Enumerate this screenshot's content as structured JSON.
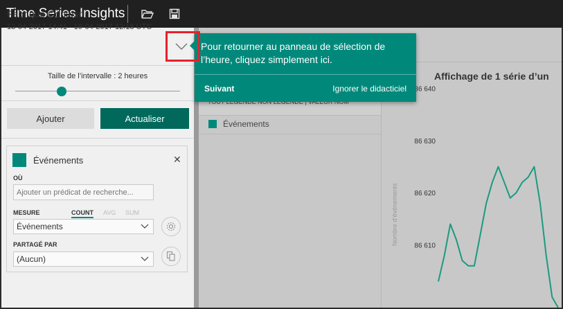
{
  "app": {
    "title": "Time Series Insights"
  },
  "environment": {
    "name": "Fabrique Contoso",
    "range": "13-04-2017 14:41  -  19-04-2017 12:18 UTC"
  },
  "interval": {
    "label": "Taille de l’intervalle : 2 heures",
    "position": 0.28
  },
  "buttons": {
    "add": "Ajouter",
    "refresh": "Actualiser"
  },
  "card": {
    "title": "Événements",
    "where_label": "OÙ",
    "predicate_placeholder": "Ajouter un prédicat de recherche...",
    "measure_label": "MESURE",
    "measure_tabs": [
      "COUNT",
      "AVG",
      "SUM"
    ],
    "measure_value": "Événements",
    "split_label": "PARTAGÉ PAR",
    "split_value": "(Aucun)",
    "accent": "#00897b"
  },
  "middle": {
    "tabs_text": "TOUT   LÉGENDE  NON LÉGENDE    |  VALEUR   NOM",
    "row_label": "Événements"
  },
  "tooltip": {
    "text": "Pour retourner au panneau de sélection de l’heure, cliquez simplement ici.",
    "next": "Suivant",
    "skip": "Ignorer le didacticiel"
  },
  "chart_data": {
    "type": "line",
    "title": "Affichage de 1 série d’un",
    "ylabel": "Nombre d’événements",
    "yticks": [
      86640,
      86630,
      86620,
      86610
    ],
    "ytick_labels": [
      "86 640",
      "86 630",
      "86 620",
      "86 610"
    ],
    "ylim": [
      86598,
      86641
    ],
    "series": [
      {
        "color": "#1a9a7f",
        "x": [
          0,
          1,
          2,
          3,
          4,
          5,
          6,
          7,
          8,
          9,
          10,
          11,
          12,
          13,
          14,
          15,
          16,
          17,
          18,
          19,
          20
        ],
        "values": [
          86603,
          86608,
          86614,
          86611,
          86607,
          86606,
          86606,
          86612,
          86618,
          86622,
          86625,
          86622,
          86619,
          86620,
          86622,
          86623,
          86625,
          86618,
          86608,
          86600,
          86598
        ]
      }
    ]
  }
}
